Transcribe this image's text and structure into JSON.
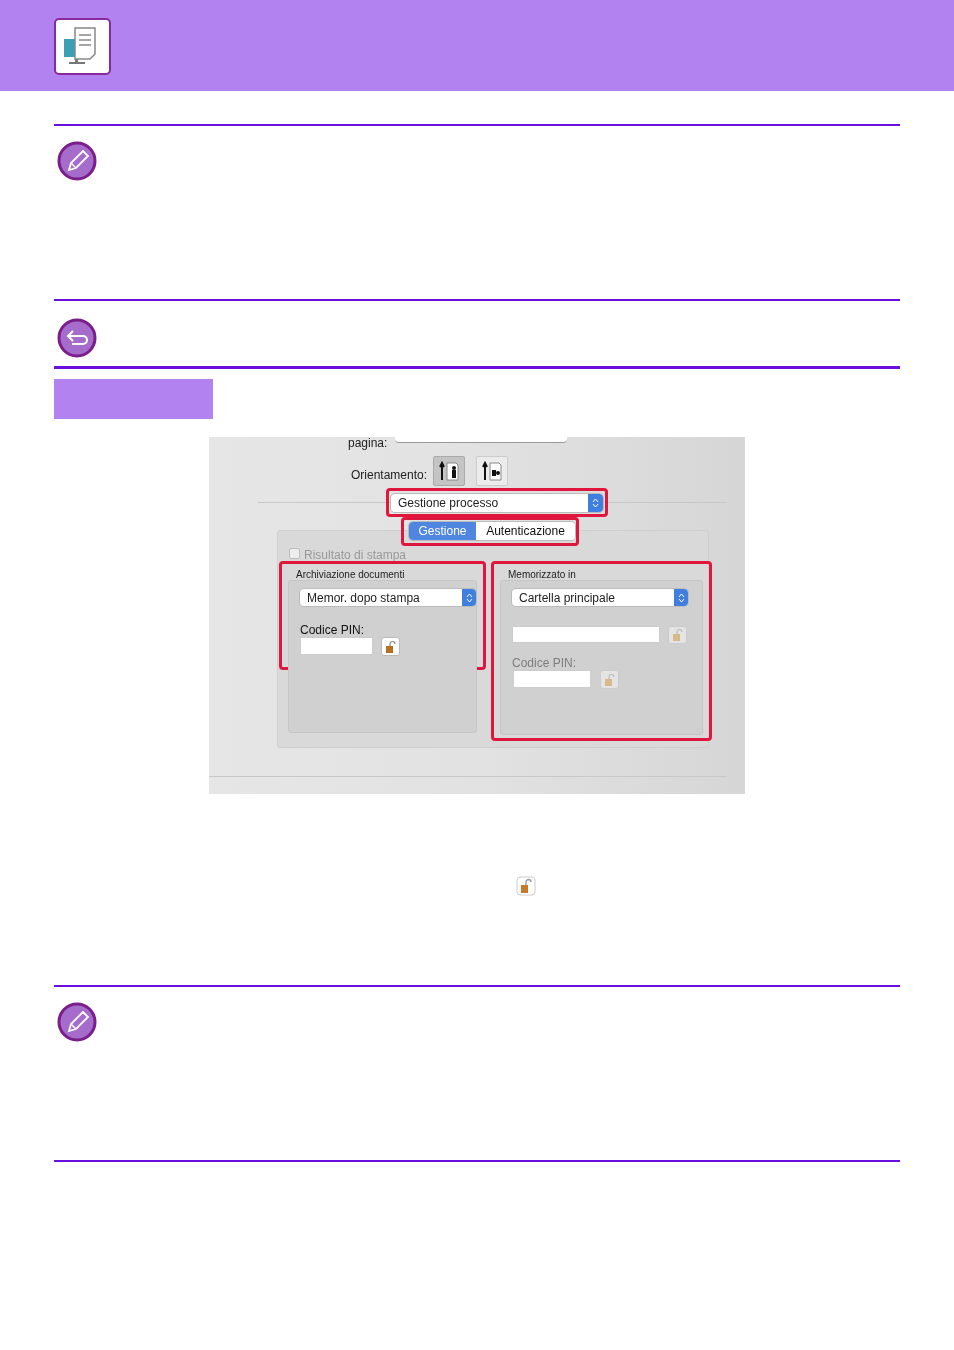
{
  "dialog": {
    "cut_label": "pagina:",
    "orientation_label": "Orientamento:",
    "orientations": [
      {
        "kind": "portrait",
        "selected": true
      },
      {
        "kind": "landscape",
        "selected": false
      }
    ],
    "panel_select": "Gestione processo",
    "tabs": [
      {
        "label": "Gestione",
        "selected": true
      },
      {
        "label": "Autenticazione",
        "selected": false
      }
    ],
    "print_result": {
      "label": "Risultato di stampa",
      "checked": false,
      "disabled": true
    },
    "groups": [
      {
        "title": "Archiviazione documenti",
        "select": "Memor. dopo stampa",
        "pin_label": "Codice PIN:",
        "disabled": false,
        "has_folder_field": false
      },
      {
        "title": "Memorizzato in",
        "select": "Cartella principale",
        "pin_label": "Codice PIN:",
        "disabled": true,
        "has_folder_field": true
      }
    ]
  }
}
